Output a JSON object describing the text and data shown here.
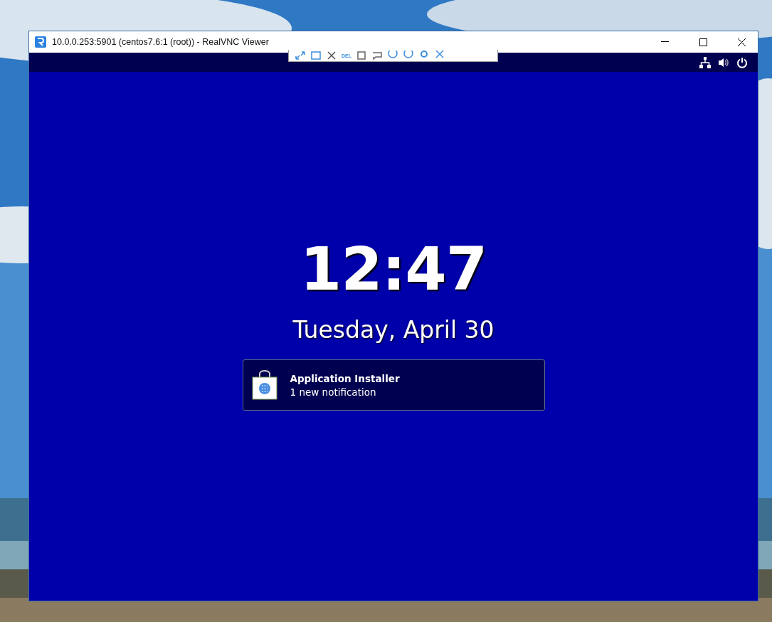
{
  "window": {
    "title": "10.0.0.253:5901 (centos7.6:1 (root)) - RealVNC Viewer"
  },
  "vnc_toolbar": {
    "del_label": "DEL"
  },
  "lock_screen": {
    "time": "12:47",
    "date": "Tuesday, April 30",
    "notifications": [
      {
        "app": "Application Installer",
        "text": "1 new notification"
      }
    ]
  }
}
